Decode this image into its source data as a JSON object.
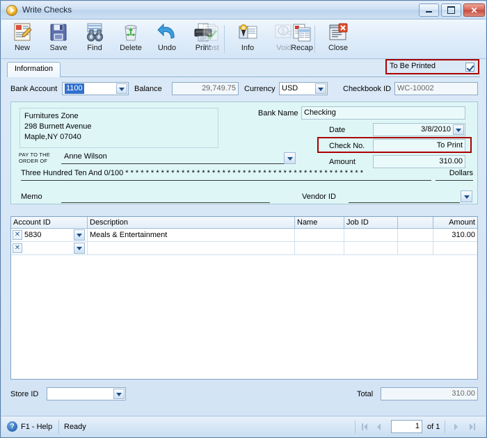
{
  "window": {
    "title": "Write Checks",
    "icon": "play-circle-icon",
    "controls": {
      "minimize": "minimize-button",
      "maximize": "maximize-button",
      "close": "✕"
    }
  },
  "toolbar": {
    "items": [
      {
        "label": "New",
        "icon": "new-document-icon",
        "enabled": true
      },
      {
        "label": "Save",
        "icon": "floppy-disk-icon",
        "enabled": true
      },
      {
        "label": "Find",
        "icon": "binoculars-icon",
        "enabled": true
      },
      {
        "label": "Delete",
        "icon": "recycle-bin-icon",
        "enabled": true
      },
      {
        "label": "Undo",
        "icon": "undo-arrow-icon",
        "enabled": true
      },
      {
        "label": "Print",
        "icon": "printer-icon",
        "enabled": true
      },
      {
        "label": "Post",
        "icon": "post-checkmark-icon",
        "enabled": false
      },
      {
        "label": "Info",
        "icon": "info-badge-icon",
        "enabled": true
      },
      {
        "label": "Void",
        "icon": "void-dollar-icon",
        "enabled": false
      },
      {
        "label": "Recap",
        "icon": "recap-report-icon",
        "enabled": true
      },
      {
        "label": "Close",
        "icon": "close-window-icon",
        "enabled": true
      }
    ]
  },
  "tabs": [
    {
      "label": "Information",
      "active": true
    }
  ],
  "to_be_printed": {
    "label": "To Be Printed",
    "checked": true,
    "highlight_color": "#aa0000"
  },
  "header_fields": {
    "bank_account_label": "Bank Account",
    "bank_account_value": "1100",
    "balance_label": "Balance",
    "balance_value": "29,749.75",
    "currency_label": "Currency",
    "currency_value": "USD",
    "checkbook_id_label": "Checkbook ID",
    "checkbook_id_value": "WC-10002"
  },
  "check": {
    "payer_name": "Furnitures Zone",
    "payer_street": "298 Burnett Avenue",
    "payer_citystate": "Maple,NY 07040",
    "pay_to_the_label_1": "PAY TO THE",
    "pay_to_the_label_2": "ORDER OF",
    "payee": "Anne Wilson",
    "amount_words": "Three Hundred Ten And 0/100 * * * * * * * * * * * * * * * * * * * * * * * * * * * * * * * * * * * * * * * * * * * * * * *",
    "dollars_label": "Dollars",
    "memo_label": "Memo",
    "memo_value": "",
    "vendor_id_label": "Vendor ID",
    "vendor_id_value": "",
    "bank_name_label": "Bank Name",
    "bank_name_value": "Checking",
    "date_label": "Date",
    "date_value": "3/8/2010",
    "check_no_label": "Check No.",
    "check_no_value": "To Print",
    "amount_label": "Amount",
    "amount_value": "310.00"
  },
  "grid": {
    "columns": [
      {
        "label": "Account ID",
        "align": "left"
      },
      {
        "label": "Description",
        "align": "left"
      },
      {
        "label": "Name",
        "align": "left"
      },
      {
        "label": "Job ID",
        "align": "left"
      },
      {
        "label": "",
        "align": "left"
      },
      {
        "label": "Amount",
        "align": "right"
      }
    ],
    "rows": [
      {
        "account_id": "5830",
        "description": "Meals & Entertainment",
        "name": "",
        "job_id": "",
        "extra": "",
        "amount": "310.00"
      },
      {
        "account_id": "",
        "description": "",
        "name": "",
        "job_id": "",
        "extra": "",
        "amount": ""
      }
    ]
  },
  "footer": {
    "store_id_label": "Store ID",
    "store_id_value": "",
    "total_label": "Total",
    "total_value": "310.00"
  },
  "statusbar": {
    "help_label": "F1 - Help",
    "status_label": "Ready",
    "page_value": "1",
    "page_of": "of 1"
  }
}
